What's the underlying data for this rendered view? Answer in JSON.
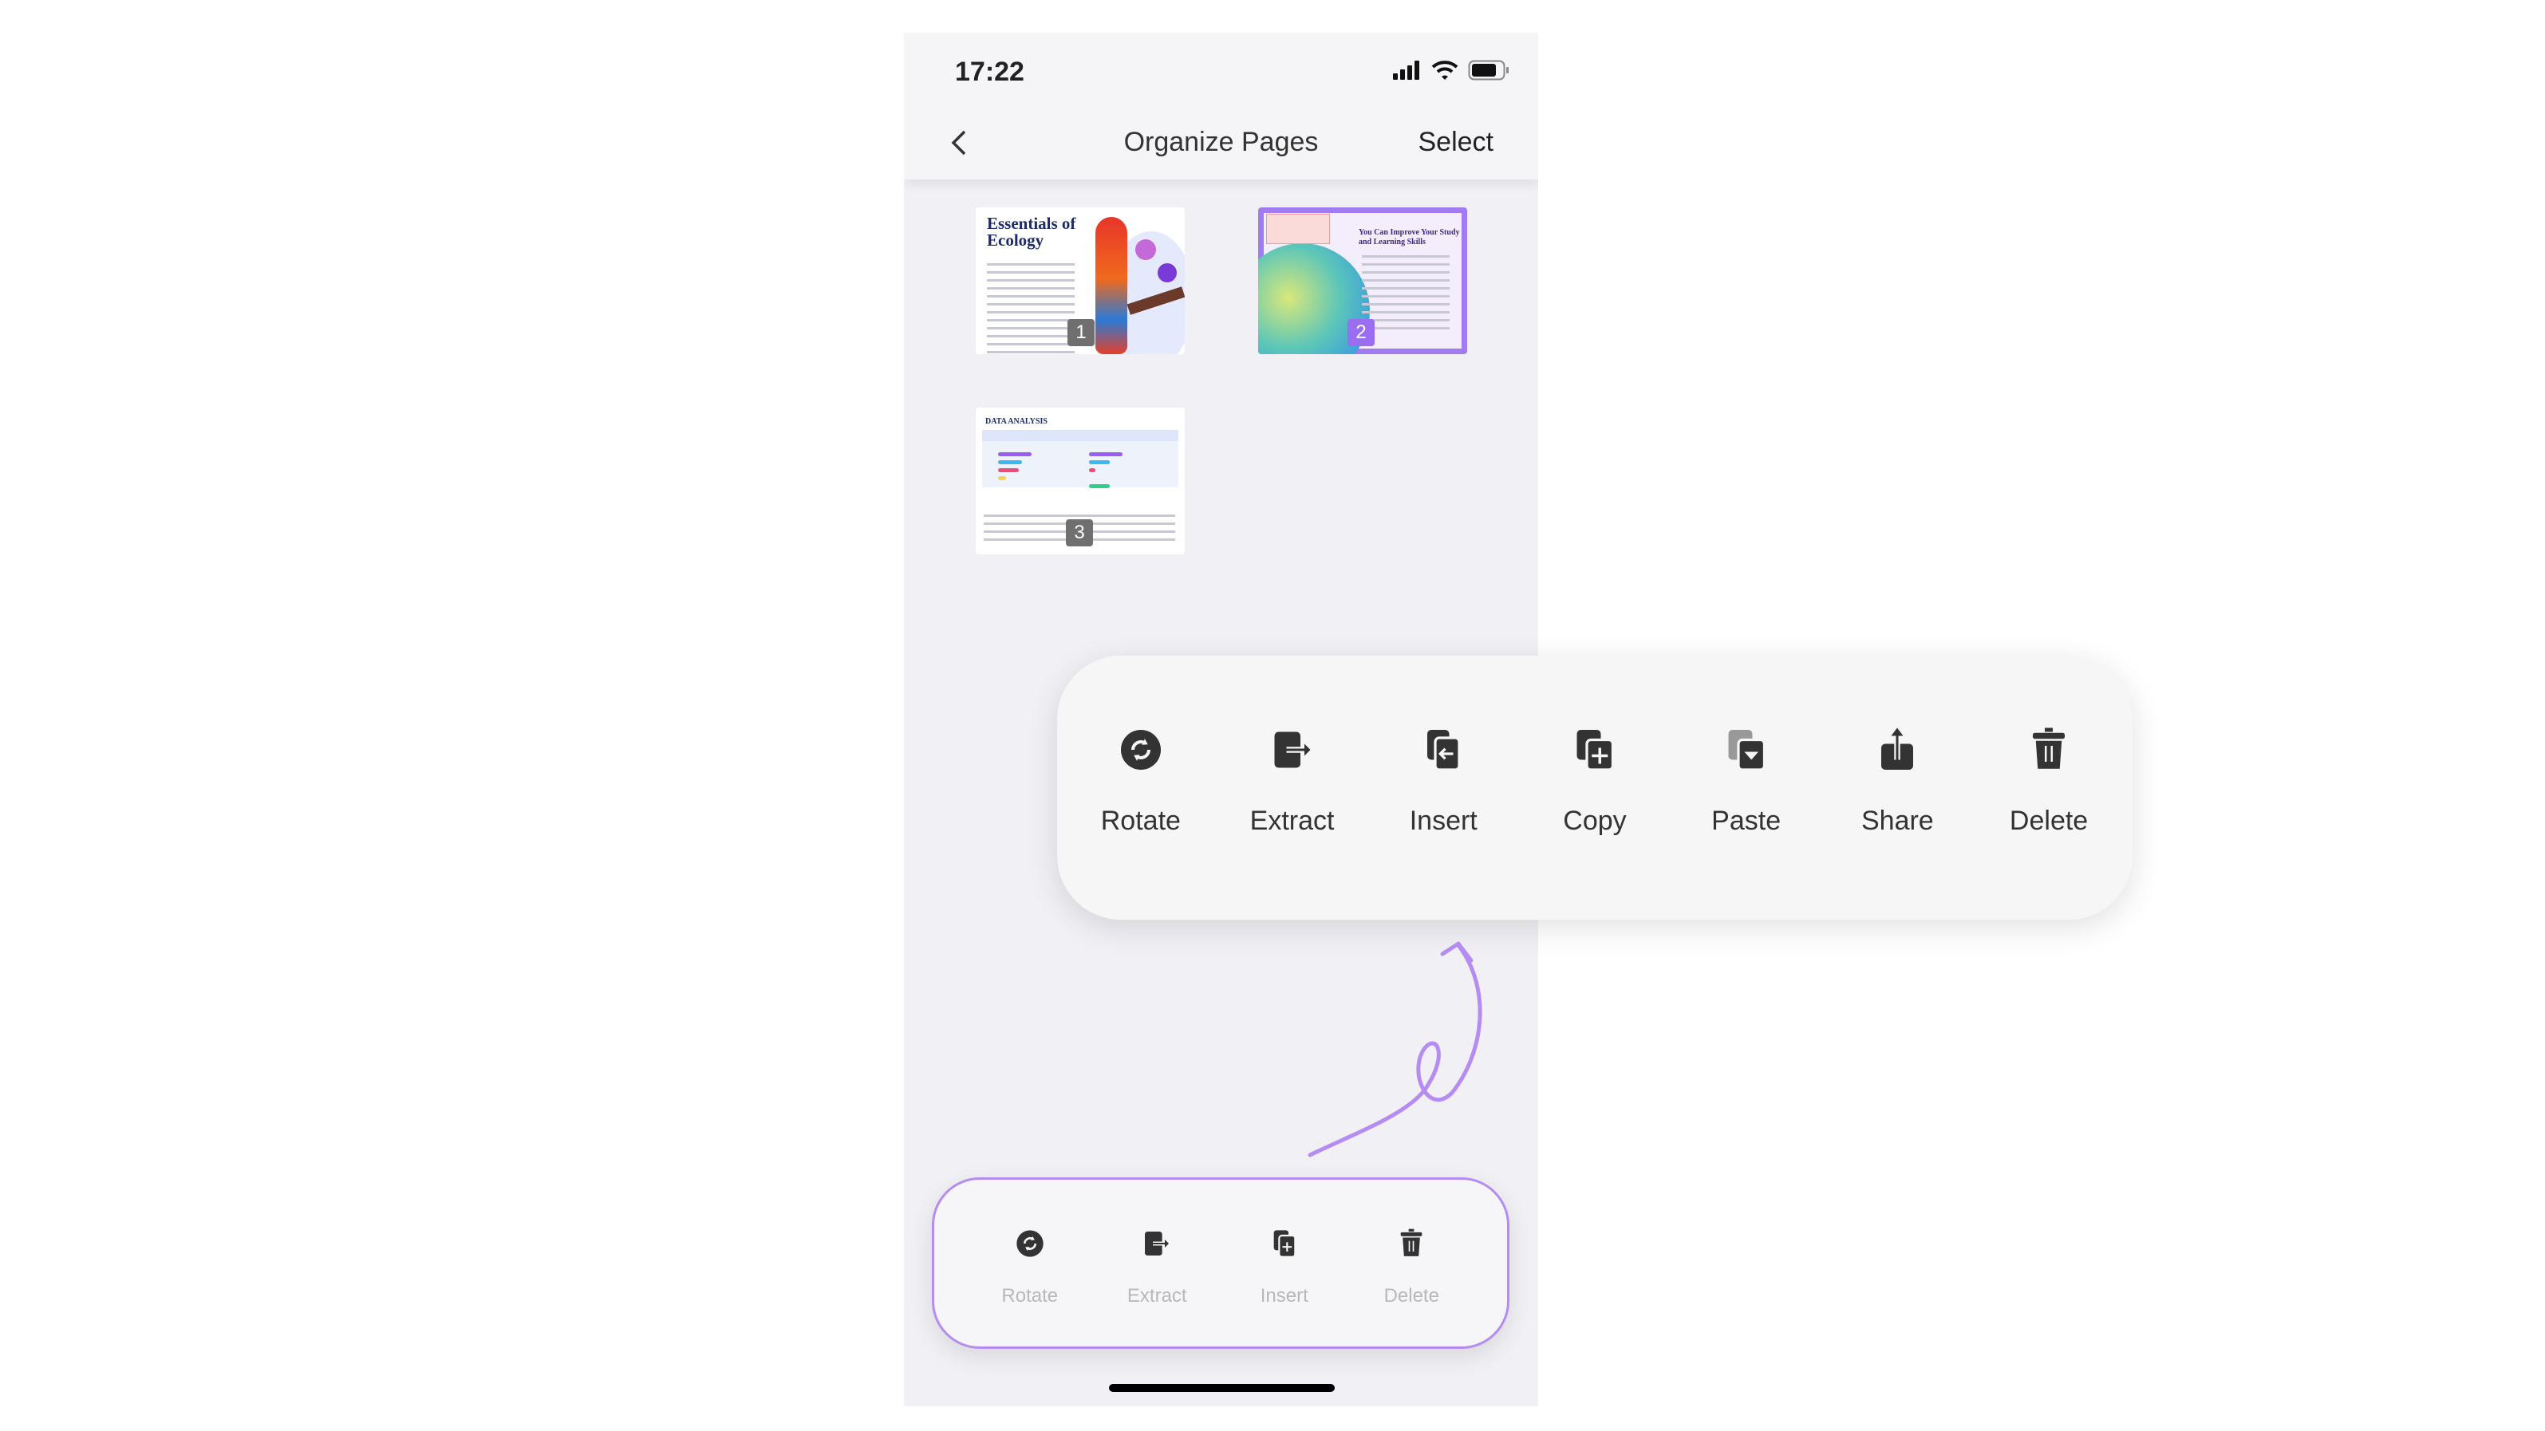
{
  "status_bar": {
    "time": "17:22",
    "icons": [
      "signal-icon",
      "wifi-icon",
      "battery-icon"
    ]
  },
  "nav": {
    "back_icon": "chevron-left-icon",
    "title": "Organize Pages",
    "select_label": "Select"
  },
  "pages": [
    {
      "number": "1",
      "heading": "Essentials of Ecology",
      "selected": false
    },
    {
      "number": "2",
      "heading": "You Can Improve Your Study and Learning Skills",
      "selected": true
    },
    {
      "number": "3",
      "heading": "DATA ANALYSIS",
      "selected": false
    }
  ],
  "popup_menu": {
    "items": [
      {
        "label": "Rotate",
        "icon": "rotate-icon"
      },
      {
        "label": "Extract",
        "icon": "extract-icon"
      },
      {
        "label": "Insert",
        "icon": "insert-icon"
      },
      {
        "label": "Copy",
        "icon": "copy-icon"
      },
      {
        "label": "Paste",
        "icon": "paste-icon"
      },
      {
        "label": "Share",
        "icon": "share-icon"
      },
      {
        "label": "Delete",
        "icon": "trash-icon"
      }
    ]
  },
  "bottom_toolbar": {
    "items": [
      {
        "label": "Rotate",
        "icon": "rotate-icon"
      },
      {
        "label": "Extract",
        "icon": "extract-icon"
      },
      {
        "label": "Insert",
        "icon": "insert-icon"
      },
      {
        "label": "Delete",
        "icon": "trash-icon"
      }
    ]
  },
  "colors": {
    "accent": "#a07cf0",
    "annotation_arrow": "#b58cf2"
  }
}
